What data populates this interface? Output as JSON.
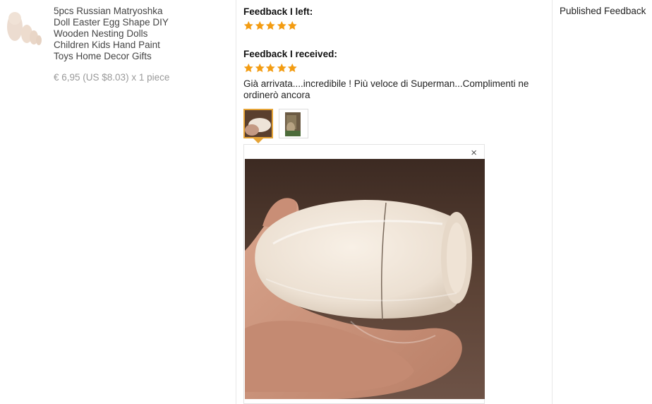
{
  "product": {
    "title": "5pcs Russian Matryoshka Doll Easter Egg Shape DIY Wooden Nesting Dolls Children Kids Hand Paint Toys Home Decor Gifts",
    "price": "€ 6,95 (US $8.03) x 1 piece",
    "thumbnail_icon": "nesting-dolls-image"
  },
  "feedback_left": {
    "heading": "Feedback I left:",
    "rating": 5
  },
  "feedback_received": {
    "heading": "Feedback I received:",
    "rating": 5,
    "comment": "Già arrivata....incredibile ! Più veloce di Superman...Complimenti ne ordinerò ancora"
  },
  "photos": {
    "selected_index": 0,
    "close_label": "×"
  },
  "status": {
    "label": "Published Feedback"
  },
  "colors": {
    "star": "#f39c12",
    "active_thumb": "#e5a336"
  }
}
